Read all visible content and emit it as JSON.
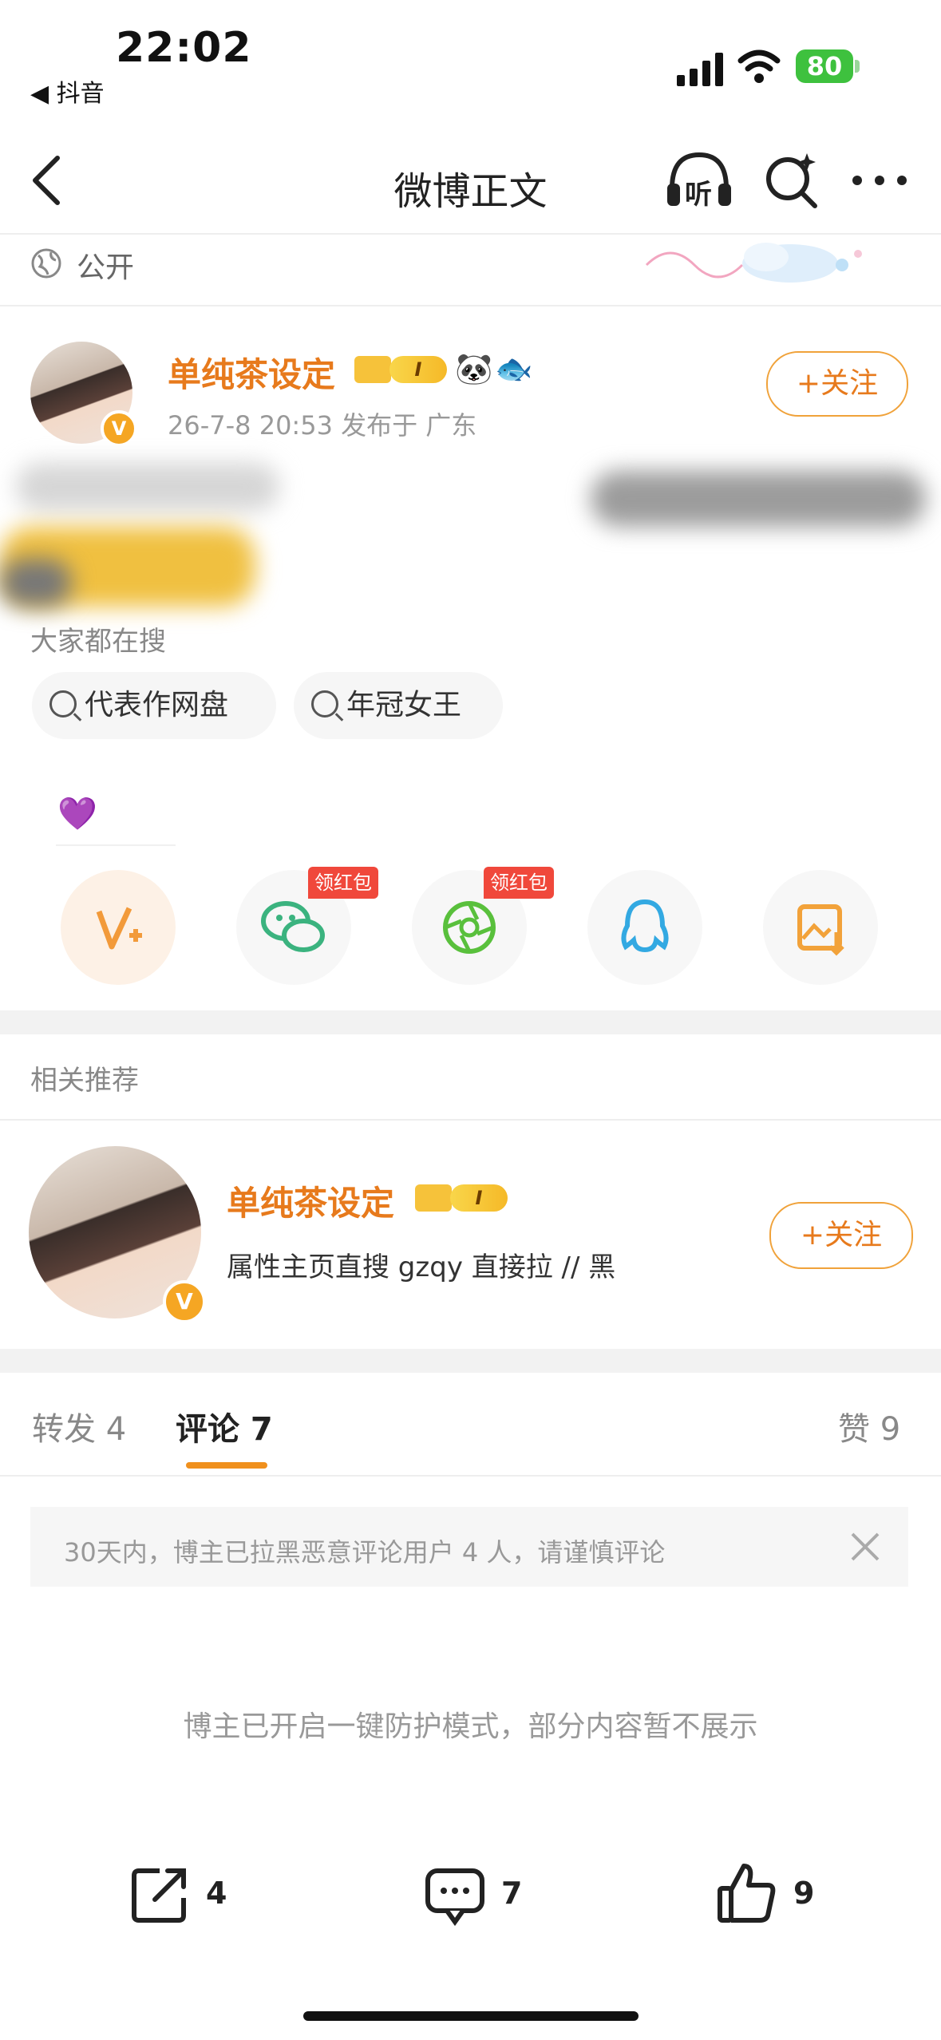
{
  "status_bar": {
    "time": "22:02",
    "back_app": "◀ 抖音",
    "battery": "80"
  },
  "nav": {
    "title": "微博正文",
    "listen_label": "听"
  },
  "visibility": {
    "label": "公开"
  },
  "post": {
    "author": "单纯茶设定",
    "level": "I",
    "meta": "26-7-8 20:53  发布于 广东",
    "follow_label": "+关注"
  },
  "search_section": {
    "label": "大家都在搜",
    "chips": [
      "代表作网盘",
      "年冠女王"
    ]
  },
  "share": {
    "redpack_label": "领红包",
    "items": [
      "vplus-icon",
      "wechat-icon",
      "moments-icon",
      "qq-icon",
      "save-image-icon"
    ]
  },
  "related": {
    "title": "相关推荐",
    "author": "单纯茶设定",
    "level": "I",
    "desc": "属性主页直搜 gzqy 直接拉 // 黑",
    "follow_label": "+关注"
  },
  "tabs": {
    "repost": "转发 4",
    "comment": "评论 7",
    "like": "赞 9"
  },
  "notice": {
    "text": "30天内，博主已拉黑恶意评论用户 4 人，请谨慎评论"
  },
  "protect_text": "博主已开启一键防护模式，部分内容暂不展示",
  "actions": {
    "repost": "4",
    "comment": "7",
    "like": "9"
  },
  "colors": {
    "accent": "#e77a1c",
    "follow_border": "#f0a23a",
    "tab_underline": "#f0901d"
  }
}
